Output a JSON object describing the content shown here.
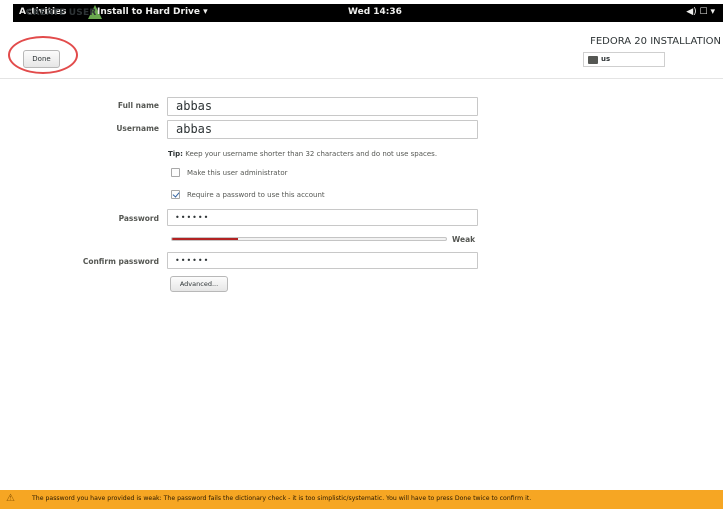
{
  "topbar": {
    "activities": "Activities",
    "app_menu": "Install to Hard Drive ▾",
    "clock": "Wed 14:36",
    "status_icons": "◀) ☐ ▾"
  },
  "header": {
    "page_title": "CREATE USER",
    "done_label": "Done",
    "install_title": "FEDORA 20 INSTALLATION",
    "keyboard_layout": "us"
  },
  "form": {
    "full_name_label": "Full name",
    "full_name_value": "abbas",
    "username_label": "Username",
    "username_value": "abbas",
    "tip_prefix": "Tip:",
    "tip_text": "Keep your username shorter than 32 characters and do not use spaces.",
    "admin_label": "Make this user administrator",
    "admin_checked": false,
    "require_password_label": "Require a password to use this account",
    "require_password_checked": true,
    "password_label": "Password",
    "password_value": "••••••",
    "strength_fraction": 0.24,
    "strength_label": "Weak",
    "confirm_label": "Confirm password",
    "confirm_value": "••••••",
    "advanced_label": "Advanced..."
  },
  "warning": {
    "icon": "warning-icon",
    "text": "The password you have provided is weak: The password fails the dictionary check - it is too simplistic/systematic. You will have to press Done twice to confirm it."
  },
  "colors": {
    "strength_weak": "#b22222",
    "warning_bar": "#f6a623",
    "annotation": "#e24b4b"
  }
}
